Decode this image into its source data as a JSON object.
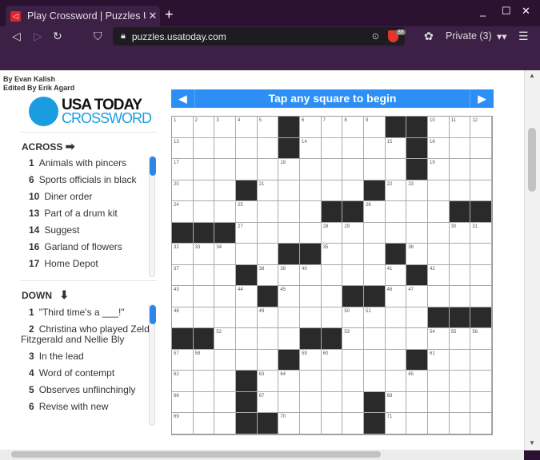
{
  "browser": {
    "tab_title": "Play Crossword | Puzzles US",
    "url": "puzzles.usatoday.com",
    "private_label": "Private (3)",
    "shield_badge": "88",
    "colors": {
      "titlebar": "#2a1230",
      "toolbar": "#3c2045"
    }
  },
  "page": {
    "byline": "By Evan Kalish",
    "editor": "Edited By Erik Agard",
    "logo": {
      "line1": "USA TODAY",
      "line2": "CROSSWORD"
    },
    "banner": {
      "text": "Tap any square to begin",
      "color": "#2b8ff5"
    },
    "across": {
      "title": "ACROSS",
      "clues": [
        {
          "num": "1",
          "text": "Animals with pincers"
        },
        {
          "num": "6",
          "text": "Sports officials in black"
        },
        {
          "num": "10",
          "text": "Diner order"
        },
        {
          "num": "13",
          "text": "Part of a drum kit"
        },
        {
          "num": "14",
          "text": "Suggest"
        },
        {
          "num": "16",
          "text": "Garland of flowers"
        },
        {
          "num": "17",
          "text": "Home Depot"
        }
      ]
    },
    "down": {
      "title": "DOWN",
      "clues": [
        {
          "num": "1",
          "text": "\"Third time's a ___!\""
        },
        {
          "num": "2",
          "text": "Christina who played Zelda Fitzgerald and Nellie Bly"
        },
        {
          "num": "3",
          "text": "In the lead"
        },
        {
          "num": "4",
          "text": "Word of contempt"
        },
        {
          "num": "5",
          "text": "Observes unflinchingly"
        },
        {
          "num": "6",
          "text": "Revise with new"
        }
      ]
    },
    "grid": {
      "rows": [
        ".....#....##...",
        ".....#.....#...",
        "...........#...",
        "...#.....#.....",
        ".......##....##",
        "###............",
        ".....##...#....",
        "...#.......#...",
        "....#...##.....",
        "............###",
        "##....##.......",
        ".....#.....#...",
        "...#...........",
        "...#.....#.....",
        "...##....#....."
      ]
    }
  }
}
